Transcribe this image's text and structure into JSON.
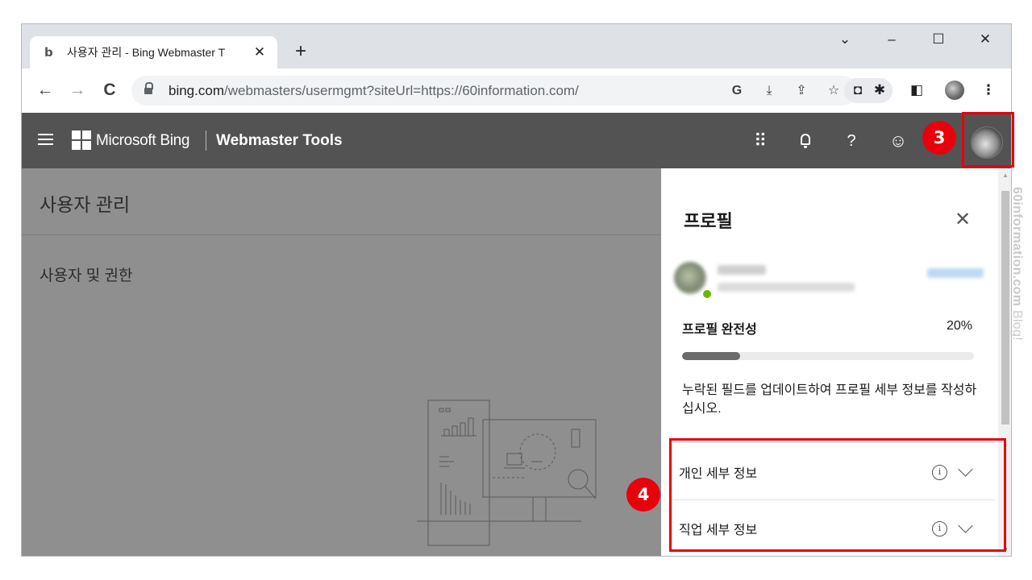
{
  "browser": {
    "tab_title": "사용자 관리 - Bing Webmaster T",
    "tab_close": "✕",
    "new_tab": "+",
    "favicon": "b",
    "url_host": "bing.com",
    "url_path": "/webmasters/usermgmt?siteUrl=https://60information.com/",
    "window_controls": {
      "dropdown": "⌄",
      "minimize": "–",
      "maximize": "☐",
      "close": "✕"
    },
    "nav": {
      "back": "←",
      "forward": "→",
      "reload": "C"
    },
    "omnibox_icons": {
      "translate": "G",
      "install": "⤓",
      "share": "⇪",
      "bookmark": "☆"
    },
    "toolbar_icons": {
      "camera": "◘",
      "extensions": "✱",
      "sidepanel": "◧",
      "menu": "⋮"
    }
  },
  "appbar": {
    "brand": "Microsoft Bing",
    "product": "Webmaster Tools",
    "icons": {
      "apps": "⠿",
      "help": "?",
      "feedback": "☺"
    }
  },
  "page": {
    "title": "사용자 관리",
    "section": "사용자 및 권한"
  },
  "profile_panel": {
    "title": "프로필",
    "close": "✕",
    "completeness_label": "프로필 완전성",
    "completeness_value": "20%",
    "completeness_fraction": 0.2,
    "description": "누락된 필드를 업데이트하여 프로필 세부 정보를 작성하십시오.",
    "sections": [
      {
        "label": "개인 세부 정보",
        "info": "i"
      },
      {
        "label": "직업 세부 정보",
        "info": "i"
      }
    ]
  },
  "annotations": {
    "step3": "3",
    "step4": "4"
  },
  "watermark": {
    "site": "60information.com",
    "suffix": " Blog!"
  },
  "colors": {
    "appbar": "#535353",
    "highlight": "#e8000b",
    "overlay": "#8f8f8f"
  }
}
